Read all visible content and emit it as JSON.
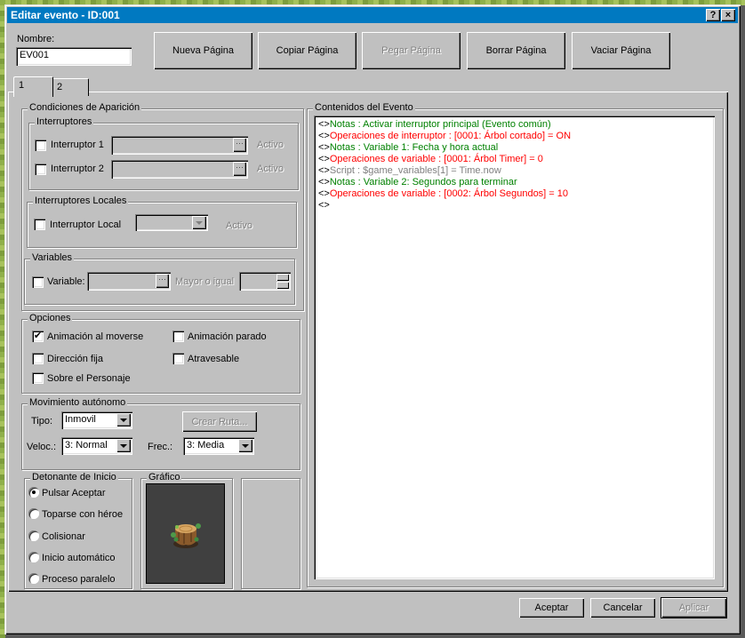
{
  "window": {
    "title": "Editar evento - ID:001",
    "help_label": "?",
    "close_label": "×"
  },
  "name_field": {
    "label": "Nombre:",
    "value": "EV001"
  },
  "toolbar": {
    "new_page": "Nueva Página",
    "copy_page": "Copiar Página",
    "paste_page": "Pegar Página",
    "delete_page": "Borrar Página",
    "clear_page": "Vaciar Página"
  },
  "tabs": [
    {
      "label": "1",
      "active": true
    },
    {
      "label": "2",
      "active": false
    }
  ],
  "conditions": {
    "title": "Condiciones de Aparición",
    "switches": {
      "title": "Interruptores",
      "switch1_label": "Interruptor 1",
      "switch2_label": "Interruptor 2",
      "state1": "Activo",
      "state2": "Activo",
      "button_label": "···"
    },
    "self_switches": {
      "title": "Interruptores Locales",
      "label": "Interruptor Local",
      "state": "Activo"
    },
    "variables": {
      "title": "Variables",
      "label": "Variable:",
      "comparison": "Mayor o igual",
      "button_label": "···"
    }
  },
  "options": {
    "title": "Opciones",
    "walk_anim": {
      "label": "Animación al moverse",
      "checked": true,
      "mark": "✔"
    },
    "step_anim": {
      "label": "Animación parado",
      "checked": false
    },
    "direction_fix": {
      "label": "Dirección fija",
      "checked": false
    },
    "through": {
      "label": "Atravesable",
      "checked": false
    },
    "priority": {
      "label": "Sobre el Personaje",
      "checked": false
    }
  },
  "movement": {
    "title": "Movimiento autónomo",
    "type_label": "Tipo:",
    "type_value": "Inmovil",
    "route_button": "Crear Ruta...",
    "speed_label": "Veloc.:",
    "speed_value": "3: Normal",
    "freq_label": "Frec.:",
    "freq_value": "3: Media"
  },
  "trigger": {
    "title": "Detonante de Inicio",
    "options": [
      {
        "label": "Pulsar Aceptar",
        "selected": true
      },
      {
        "label": "Toparse con héroe",
        "selected": false
      },
      {
        "label": "Colisionar",
        "selected": false
      },
      {
        "label": "Inicio automático",
        "selected": false
      },
      {
        "label": "Proceso paralelo",
        "selected": false
      }
    ]
  },
  "graphic": {
    "title": "Gráfico",
    "sprite": "tree-stump"
  },
  "contents": {
    "title": "Contenidos del Evento",
    "commands": [
      {
        "prefix": "<>",
        "text": "Notas : Activar interruptor principal (Evento común)",
        "color": "#008000"
      },
      {
        "prefix": "<>",
        "text": "Operaciones de interruptor : [0001: Árbol cortado] = ON",
        "color": "#ff0000"
      },
      {
        "prefix": "<>",
        "text": "Notas : Variable 1: Fecha y hora actual",
        "color": "#008000"
      },
      {
        "prefix": "<>",
        "text": "Operaciones de variable : [0001: Árbol Timer] = 0",
        "color": "#ff0000"
      },
      {
        "prefix": "<>",
        "text": "Script : $game_variables[1] = Time.now",
        "color": "#808080"
      },
      {
        "prefix": "<>",
        "text": "Notas : Variable 2: Segundos para terminar",
        "color": "#008000"
      },
      {
        "prefix": "<>",
        "text": "Operaciones de variable : [0002: Árbol Segundos] = 10",
        "color": "#ff0000"
      },
      {
        "prefix": "<>",
        "text": "",
        "color": "#000000"
      }
    ]
  },
  "footer": {
    "ok": "Aceptar",
    "cancel": "Cancelar",
    "apply": "Aplicar"
  },
  "colors": {
    "titlebar": "#0079c1",
    "face": "#c0c0c0",
    "note": "#008000",
    "operation": "#ff0000",
    "script": "#808080"
  }
}
